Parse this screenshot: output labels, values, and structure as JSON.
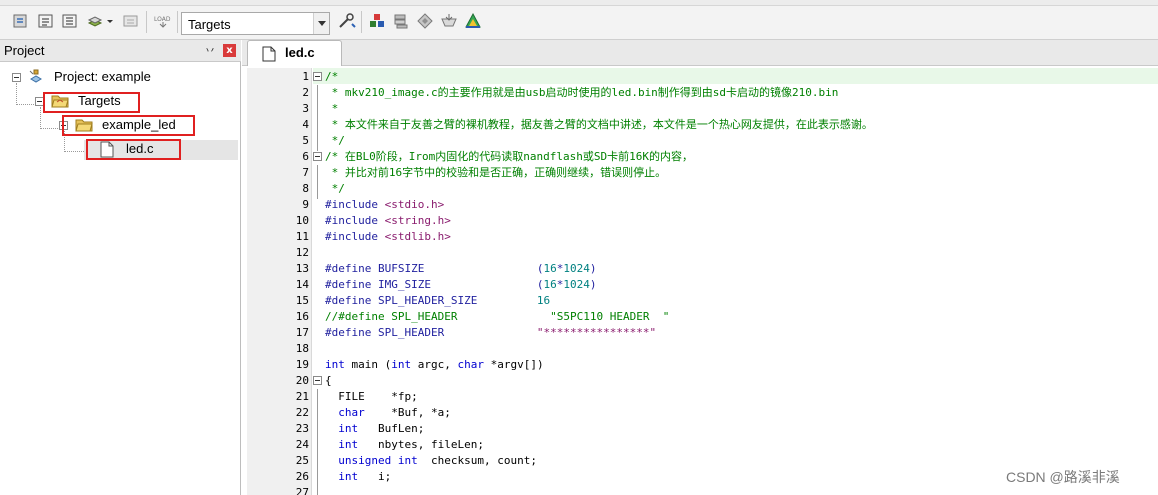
{
  "toolbar": {
    "target_select": {
      "value": "Targets"
    },
    "icons": [
      "translate-icon",
      "build-icon",
      "rebuild-icon",
      "batch-build-icon",
      "dropdown-arrow-icon",
      "stop-build-icon",
      "download-load-icon",
      "target-options-icon",
      "file-extensions-icon",
      "manage-components-icon",
      "select-packs-icon",
      "pack-installer-icon",
      "run-time-env-icon"
    ]
  },
  "project_panel": {
    "title": "Project",
    "pin": "丷",
    "close": "x",
    "tree": [
      {
        "label": "Project: example",
        "icon": "project-icon"
      },
      {
        "label": "Targets",
        "icon": "folder-open-icon"
      },
      {
        "label": "example_led",
        "icon": "folder-open-icon"
      },
      {
        "label": "led.c",
        "icon": "file-icon"
      }
    ]
  },
  "editor": {
    "tab_label": "led.c",
    "lines": [
      {
        "n": "1",
        "fold": true,
        "segs": [
          {
            "c": "c-comment",
            "t": "/*"
          }
        ]
      },
      {
        "n": "2",
        "segs": [
          {
            "c": "c-comment",
            "t": " * mkv210_image.c的主要作用就是由usb启动时使用的led.bin制作得到由sd卡启动的镜像210.bin"
          }
        ]
      },
      {
        "n": "3",
        "segs": [
          {
            "c": "c-comment",
            "t": " *"
          }
        ]
      },
      {
        "n": "4",
        "segs": [
          {
            "c": "c-comment",
            "t": " * 本文件来自于友善之臂的裸机教程，据友善之臂的文档中讲述，本文件是一个热心网友提供，在此表示感谢。"
          }
        ]
      },
      {
        "n": "5",
        "segs": [
          {
            "c": "c-comment",
            "t": " */"
          }
        ]
      },
      {
        "n": "6",
        "fold": true,
        "segs": [
          {
            "c": "c-comment",
            "t": "/* 在BL0阶段，Irom内固化的代码读取nandflash或SD卡前16K的内容，"
          }
        ]
      },
      {
        "n": "7",
        "segs": [
          {
            "c": "c-comment",
            "t": " * 并比对前16字节中的校验和是否正确，正确则继续，错误则停止。"
          }
        ]
      },
      {
        "n": "8",
        "segs": [
          {
            "c": "c-comment",
            "t": " */"
          }
        ]
      },
      {
        "n": "9",
        "segs": [
          {
            "c": "c-pp",
            "t": "#include "
          },
          {
            "c": "c-str",
            "t": "<stdio.h>"
          }
        ]
      },
      {
        "n": "10",
        "segs": [
          {
            "c": "c-pp",
            "t": "#include "
          },
          {
            "c": "c-str",
            "t": "<string.h>"
          }
        ]
      },
      {
        "n": "11",
        "segs": [
          {
            "c": "c-pp",
            "t": "#include "
          },
          {
            "c": "c-str",
            "t": "<stdlib.h>"
          }
        ]
      },
      {
        "n": "12",
        "segs": []
      },
      {
        "n": "13",
        "segs": [
          {
            "c": "c-pp",
            "t": "#define BUFSIZE                 ("
          },
          {
            "c": "c-num",
            "t": "16"
          },
          {
            "c": "c-pp",
            "t": "*"
          },
          {
            "c": "c-num",
            "t": "1024"
          },
          {
            "c": "c-pp",
            "t": ")"
          }
        ]
      },
      {
        "n": "14",
        "segs": [
          {
            "c": "c-pp",
            "t": "#define IMG_SIZE                ("
          },
          {
            "c": "c-num",
            "t": "16"
          },
          {
            "c": "c-pp",
            "t": "*"
          },
          {
            "c": "c-num",
            "t": "1024"
          },
          {
            "c": "c-pp",
            "t": ")"
          }
        ]
      },
      {
        "n": "15",
        "segs": [
          {
            "c": "c-pp",
            "t": "#define SPL_HEADER_SIZE         "
          },
          {
            "c": "c-num",
            "t": "16"
          }
        ]
      },
      {
        "n": "16",
        "segs": [
          {
            "c": "c-comment",
            "t": "//#define SPL_HEADER              \"S5PC110 HEADER  \""
          }
        ]
      },
      {
        "n": "17",
        "segs": [
          {
            "c": "c-pp",
            "t": "#define SPL_HEADER              "
          },
          {
            "c": "c-str",
            "t": "\"****************\""
          }
        ]
      },
      {
        "n": "18",
        "segs": []
      },
      {
        "n": "19",
        "segs": [
          {
            "c": "c-kw",
            "t": "int"
          },
          {
            "c": "",
            "t": " main ("
          },
          {
            "c": "c-kw",
            "t": "int"
          },
          {
            "c": "",
            "t": " argc, "
          },
          {
            "c": "c-kw",
            "t": "char"
          },
          {
            "c": "",
            "t": " *argv[])"
          }
        ]
      },
      {
        "n": "20",
        "fold": true,
        "segs": [
          {
            "c": "",
            "t": "{"
          }
        ]
      },
      {
        "n": "21",
        "segs": [
          {
            "c": "",
            "t": "  FILE    *fp;"
          }
        ]
      },
      {
        "n": "22",
        "segs": [
          {
            "c": "",
            "t": "  "
          },
          {
            "c": "c-kw",
            "t": "char"
          },
          {
            "c": "",
            "t": "    *Buf, *a;"
          }
        ]
      },
      {
        "n": "23",
        "segs": [
          {
            "c": "",
            "t": "  "
          },
          {
            "c": "c-kw",
            "t": "int"
          },
          {
            "c": "",
            "t": "   BufLen;"
          }
        ]
      },
      {
        "n": "24",
        "segs": [
          {
            "c": "",
            "t": "  "
          },
          {
            "c": "c-kw",
            "t": "int"
          },
          {
            "c": "",
            "t": "   nbytes, fileLen;"
          }
        ]
      },
      {
        "n": "25",
        "segs": [
          {
            "c": "",
            "t": "  "
          },
          {
            "c": "c-kw",
            "t": "unsigned"
          },
          {
            "c": "",
            "t": " "
          },
          {
            "c": "c-kw",
            "t": "int"
          },
          {
            "c": "",
            "t": "  checksum, count;"
          }
        ]
      },
      {
        "n": "26",
        "segs": [
          {
            "c": "",
            "t": "  "
          },
          {
            "c": "c-kw",
            "t": "int"
          },
          {
            "c": "",
            "t": "   i;"
          }
        ]
      },
      {
        "n": "27",
        "segs": []
      }
    ]
  },
  "watermark": "CSDN @路溪非溪",
  "colors": {
    "highlight_box": "#e02020",
    "comment": "#008000",
    "keyword": "#0000d0",
    "string": "#8a1c6e",
    "number": "#008080"
  }
}
